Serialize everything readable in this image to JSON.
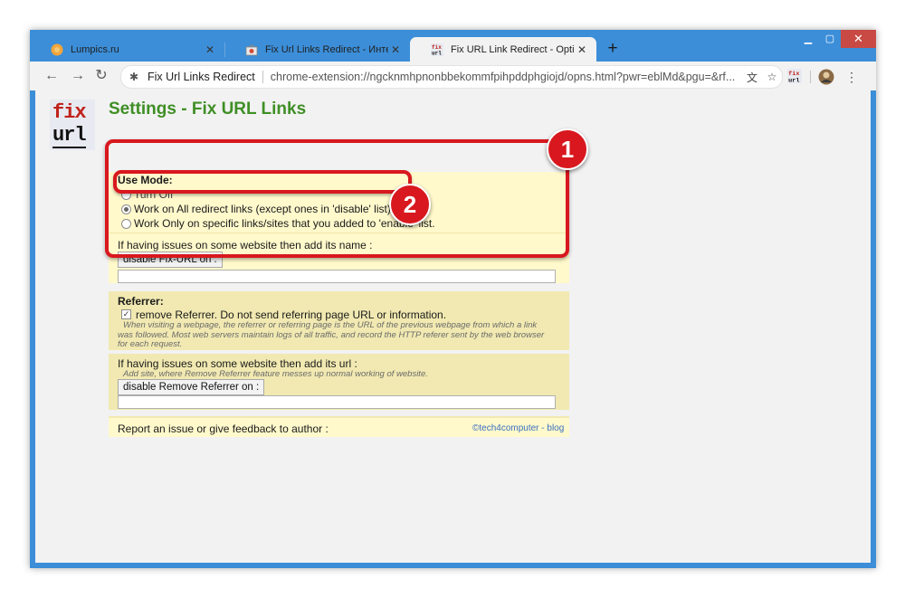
{
  "tabs": [
    {
      "label": "Lumpics.ru",
      "icon": "orange-circle-icon"
    },
    {
      "label": "Fix Url Links Redirect - Интернет",
      "icon": "chrome-store-icon"
    },
    {
      "label": "Fix URL Link Redirect - Options",
      "icon": "fixurl-icon"
    }
  ],
  "toolbar": {
    "extension_name": "Fix Url Links Redirect",
    "url": "chrome-extension://ngcknmhpnonbbekommfpihpddphgiojd/opns.html?pwr=eblMd&pgu=&rf..."
  },
  "page": {
    "logo_line1": "fix",
    "logo_line2": "url",
    "title": "Settings - Fix URL Links"
  },
  "use_mode": {
    "heading": "Use Mode:",
    "opt_off": "Turn Off",
    "opt_all": "Work on All redirect links (except ones in 'disable' list)",
    "opt_specific": "Work Only on specific links/sites that you added to 'enable' list.",
    "issue_text": "If having issues on some website then add its name :",
    "disable_button": "disable Fix-URL on :"
  },
  "referrer": {
    "heading": "Referrer:",
    "checkbox_label": "remove Referrer. Do not send referring page URL or information.",
    "desc_line1": "When visiting a webpage, the referrer or referring page is the URL of the previous webpage from which a link",
    "desc_line2": "was followed. Most web servers maintain logs of all traffic, and record the HTTP referer sent by the web browser",
    "desc_line3": "for each request."
  },
  "referrer_issue": {
    "text": "If having issues on some website then add its url :",
    "hint": "Add site, where Remove Referrer feature messes up normal working of website.",
    "button": "disable Remove Referrer on :"
  },
  "footer": {
    "report": "Report an issue or give feedback to author :",
    "credit": "©tech4computer - blog"
  },
  "annotations": {
    "badge1": "1",
    "badge2": "2"
  },
  "colors": {
    "accent_red": "#d8181e",
    "title_green": "#3f8f25",
    "panel_yellow": "#fff9cc",
    "chrome_blue": "#3c8ed8"
  }
}
